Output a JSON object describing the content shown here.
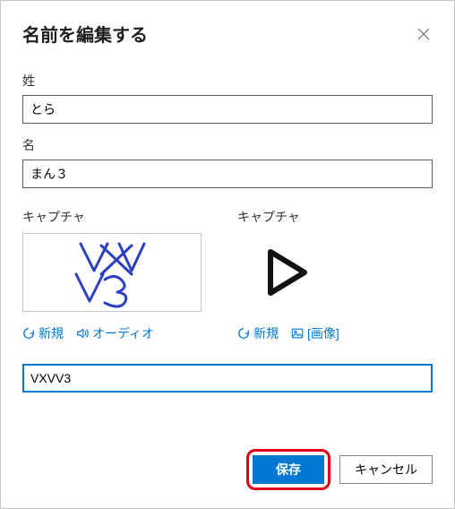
{
  "dialog": {
    "title": "名前を編集する"
  },
  "fields": {
    "lastname_label": "姓",
    "lastname_value": "とら",
    "firstname_label": "名",
    "firstname_value": "まん３"
  },
  "captcha": {
    "image_label": "キャプチャ",
    "audio_label": "キャプチャ",
    "image_text_hint": "VXVV3",
    "refresh_label": "新規",
    "audio_label_action": "オーディオ",
    "image_label_action": "[画像]",
    "input_value": "VXVV3"
  },
  "buttons": {
    "save": "保存",
    "cancel": "キャンセル"
  }
}
